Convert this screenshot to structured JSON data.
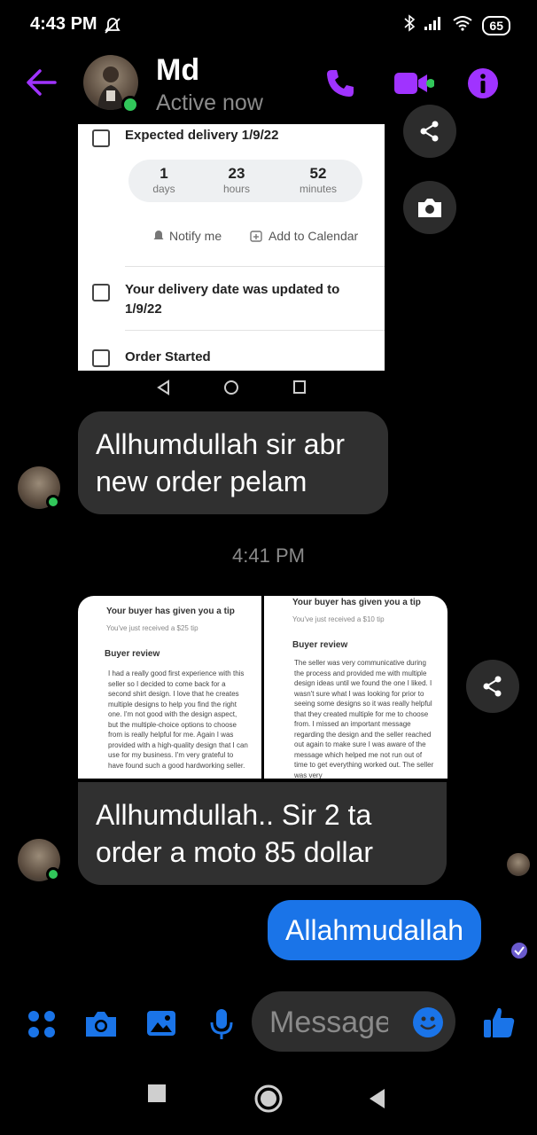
{
  "status_bar": {
    "time": "4:43 PM",
    "battery": "65"
  },
  "header": {
    "name": "Md",
    "status": "Active now"
  },
  "shared_screenshot": {
    "expected_delivery": "Expected delivery 1/9/22",
    "countdown": [
      {
        "value": "1",
        "unit": "days"
      },
      {
        "value": "23",
        "unit": "hours"
      },
      {
        "value": "52",
        "unit": "minutes"
      }
    ],
    "notify_label": "Notify me",
    "calendar_label": "Add to Calendar",
    "update_line1": "Your delivery date was updated to",
    "update_line2": "1/9/22",
    "order_started": "Order Started"
  },
  "messages": {
    "m1": {
      "line1": "Allhumdullah sir abr",
      "line2": "new order pelam"
    },
    "timestamp": "4:41 PM",
    "m2": {
      "line1": "Allhumdullah..  Sir 2 ta",
      "line2": "order a moto 85 dollar"
    },
    "m3": "Allahmudallah"
  },
  "review_left": {
    "tip_title": "Your buyer has given you a tip",
    "tip_sub": "You've just received a $25 tip",
    "review_title": "Buyer review",
    "review_text": "I had a really good first experience with this seller so I decided to come back for a second shirt design. I love that he creates multiple designs to help you find the right one. I'm not good with the design aspect, but the multiple-choice options to choose from is really helpful for me. Again I was provided with a high-quality design that I can use for my business. I'm very grateful to have found such a good hardworking seller."
  },
  "review_right": {
    "tip_title": "Your buyer has given you a tip",
    "tip_sub": "You've just received a $10 tip",
    "review_title": "Buyer review",
    "review_text": "The seller was very communicative during the process and provided me with multiple design ideas until we found the one I liked. I wasn't sure what I was looking for prior to seeing some designs so it was really helpful that they created multiple for me to choose from. I missed an important message regarding the design and the seller reached out again to make sure I was aware of the message which helped me not run out of time to get everything worked out. The seller was very"
  },
  "composer": {
    "placeholder": "Message"
  },
  "colors": {
    "accent_purple": "#a033ff",
    "messenger_blue": "#1a74e8",
    "bubble_grey": "#303030"
  }
}
